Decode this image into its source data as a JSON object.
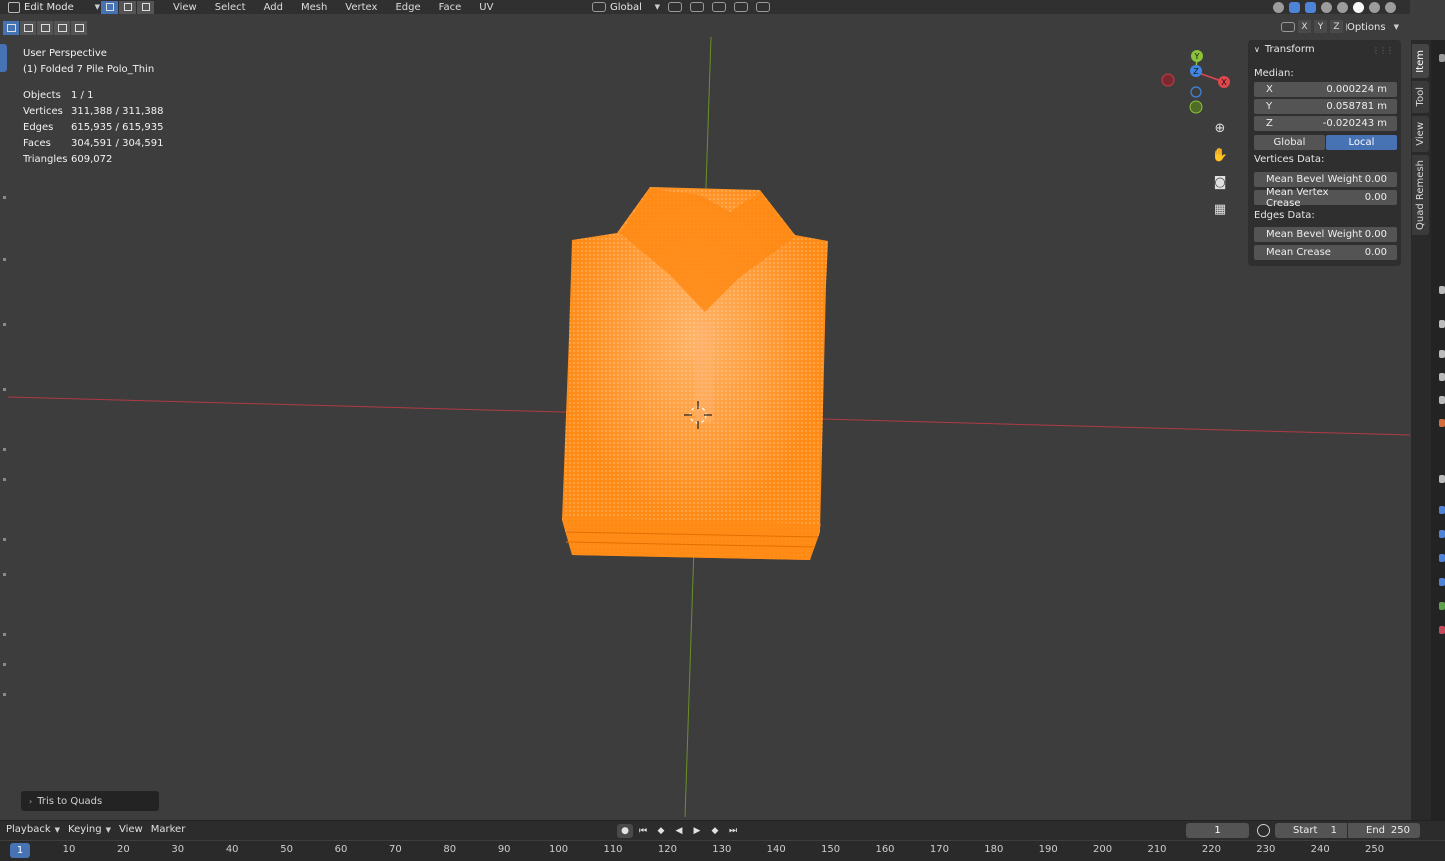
{
  "header": {
    "mode_label": "Edit Mode",
    "menu": [
      "View",
      "Select",
      "Add",
      "Mesh",
      "Vertex",
      "Edge",
      "Face",
      "UV"
    ],
    "orientation": "Global",
    "options_label": "Options",
    "axes": [
      "X",
      "Y",
      "Z"
    ]
  },
  "overlay": {
    "view_name": "User Perspective",
    "object_name": "(1) Folded 7 Pile Polo_Thin",
    "stats": [
      {
        "label": "Objects",
        "value": "1 / 1"
      },
      {
        "label": "Vertices",
        "value": "311,388 / 311,388"
      },
      {
        "label": "Edges",
        "value": "615,935 / 615,935"
      },
      {
        "label": "Faces",
        "value": "304,591 / 304,591"
      },
      {
        "label": "Triangles",
        "value": "609,072"
      }
    ]
  },
  "gizmo": {
    "axis_y": "Y",
    "axis_z": "Z",
    "axis_x": "X",
    "color_x": "#e0464d",
    "color_y": "#8ac23a",
    "color_z": "#3f86e3"
  },
  "transform_panel": {
    "title": "Transform",
    "median_label": "Median:",
    "x": {
      "label": "X",
      "value": "0.000224 m"
    },
    "y": {
      "label": "Y",
      "value": "0.058781 m"
    },
    "z": {
      "label": "Z",
      "value": "-0.020243 m"
    },
    "space_global": "Global",
    "space_local": "Local",
    "vertices_data_label": "Vertices Data:",
    "mean_bevel_weight_v": {
      "label": "Mean Bevel Weight",
      "value": "0.00"
    },
    "mean_vertex_crease": {
      "label": "Mean Vertex Crease",
      "value": "0.00"
    },
    "edges_data_label": "Edges Data:",
    "mean_bevel_weight_e": {
      "label": "Mean Bevel Weight",
      "value": "0.00"
    },
    "mean_crease": {
      "label": "Mean Crease",
      "value": "0.00"
    }
  },
  "sidebar_tabs": [
    "Item",
    "Tool",
    "View",
    "Quad Remesh"
  ],
  "last_operator": "Tris to Quads",
  "timeline": {
    "menus": [
      "Playback",
      "Keying",
      "View",
      "Marker"
    ],
    "current_frame": "1",
    "start_label": "Start",
    "start_value": "1",
    "end_label": "End",
    "end_value": "250",
    "ruler_current": "1",
    "ruler_marks": [
      "10",
      "20",
      "30",
      "40",
      "50",
      "60",
      "70",
      "80",
      "90",
      "100",
      "110",
      "120",
      "130",
      "140",
      "150",
      "160",
      "170",
      "180",
      "190",
      "200",
      "210",
      "220",
      "230",
      "240",
      "250"
    ]
  },
  "colors": {
    "mesh_orange": "#ff8a14",
    "accent_blue": "#4772b3",
    "x_axis_line": "#b03a44",
    "y_axis_line": "#6b8f2a"
  }
}
